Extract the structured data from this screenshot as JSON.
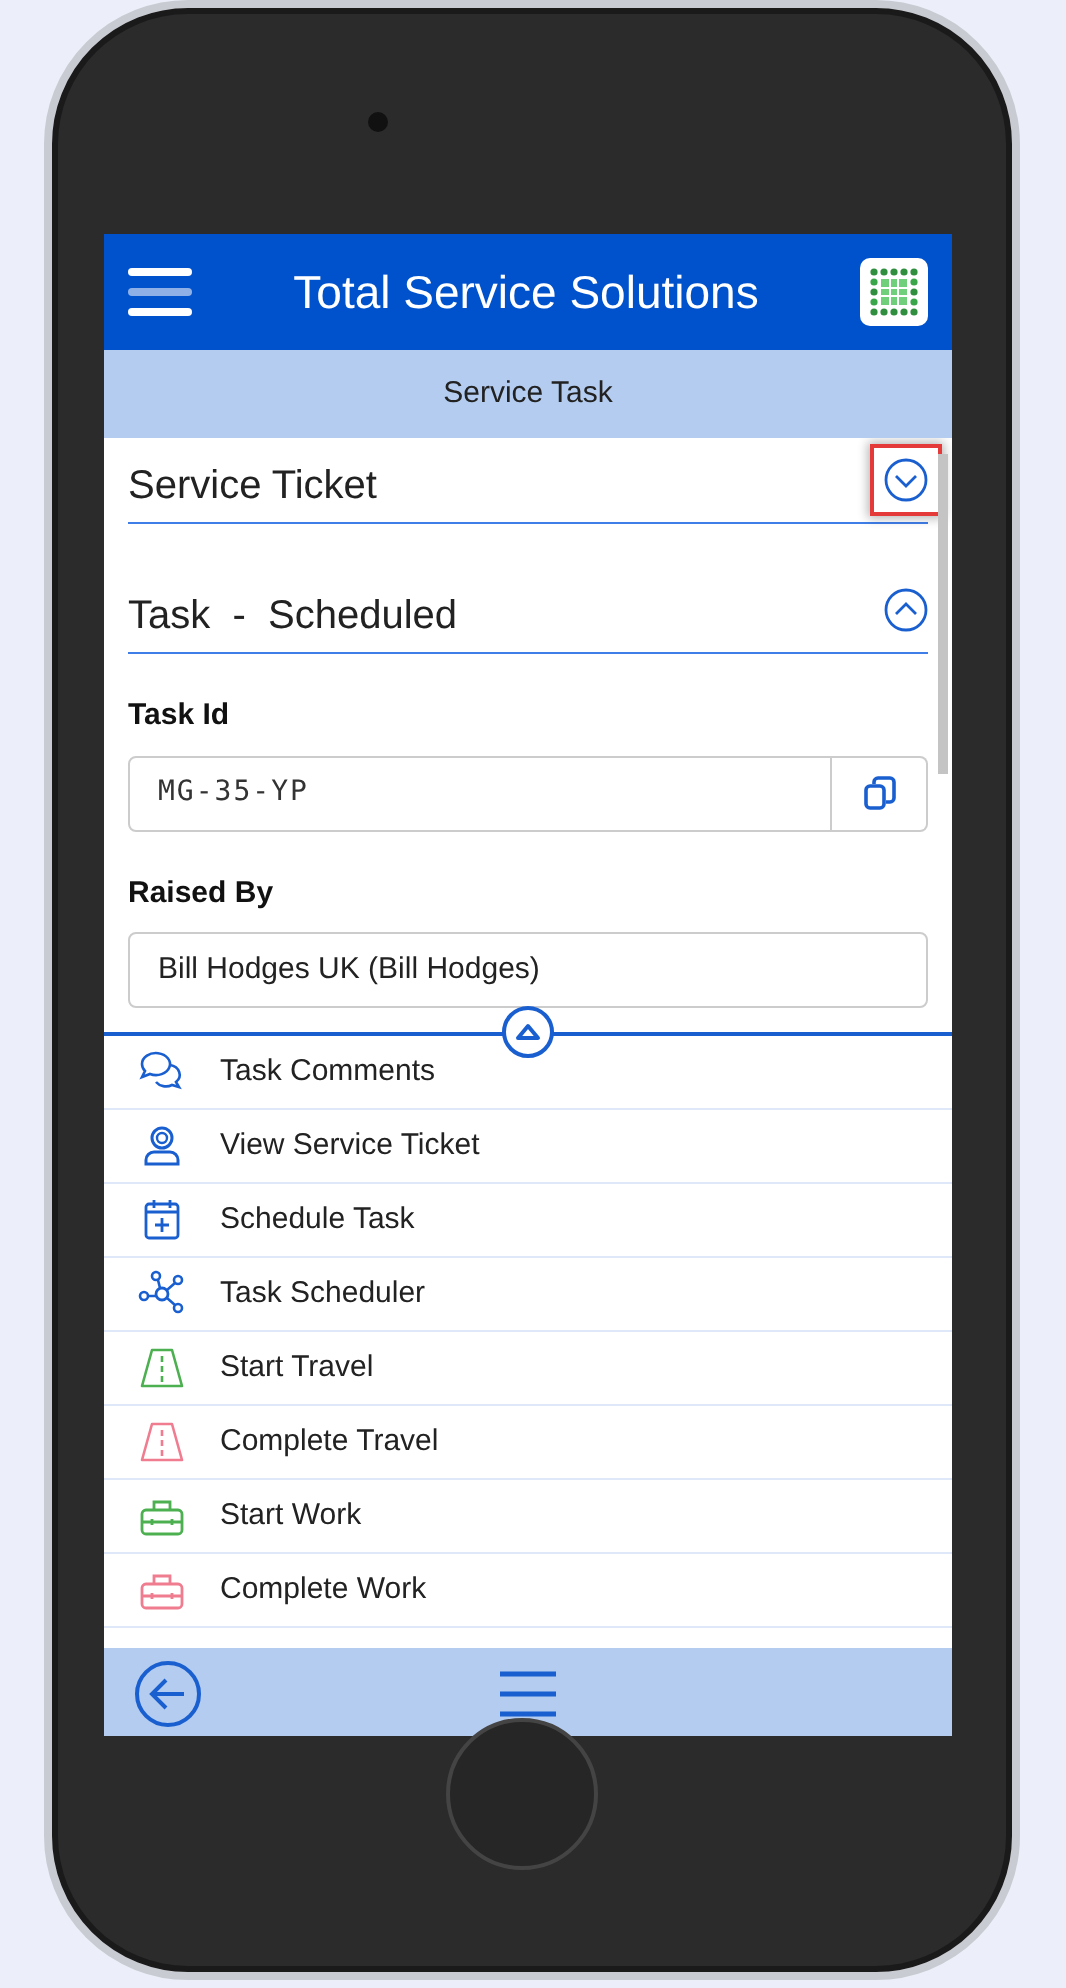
{
  "app_bar": {
    "title": "Total Service Solutions"
  },
  "sub_header": {
    "title": "Service Task"
  },
  "sections": [
    {
      "title": "Service Ticket",
      "expanded": false,
      "highlighted": true
    },
    {
      "title": "Task  -  Scheduled",
      "expanded": true,
      "fields": [
        {
          "label": "Task Id",
          "value": "MG-35-YP",
          "kind": "copy"
        },
        {
          "label": "Raised By",
          "value": "Bill Hodges UK (Bill Hodges)",
          "kind": "text"
        }
      ]
    }
  ],
  "panel_toggle": {
    "expanded": true
  },
  "actions": [
    {
      "label": "Task Comments",
      "kind": "comments",
      "color": "#1a5fd0"
    },
    {
      "label": "View Service Ticket",
      "kind": "person",
      "color": "#1a5fd0"
    },
    {
      "label": "Schedule Task",
      "kind": "calendar",
      "color": "#1a5fd0"
    },
    {
      "label": "Task Scheduler",
      "kind": "network",
      "color": "#1a5fd0"
    },
    {
      "label": "Start Travel",
      "kind": "road",
      "color": "#4caf50"
    },
    {
      "label": "Complete Travel",
      "kind": "road",
      "color": "#f07c90"
    },
    {
      "label": "Start Work",
      "kind": "toolbox",
      "color": "#4caf50"
    },
    {
      "label": "Complete Work",
      "kind": "toolbox",
      "color": "#f07c90"
    }
  ]
}
